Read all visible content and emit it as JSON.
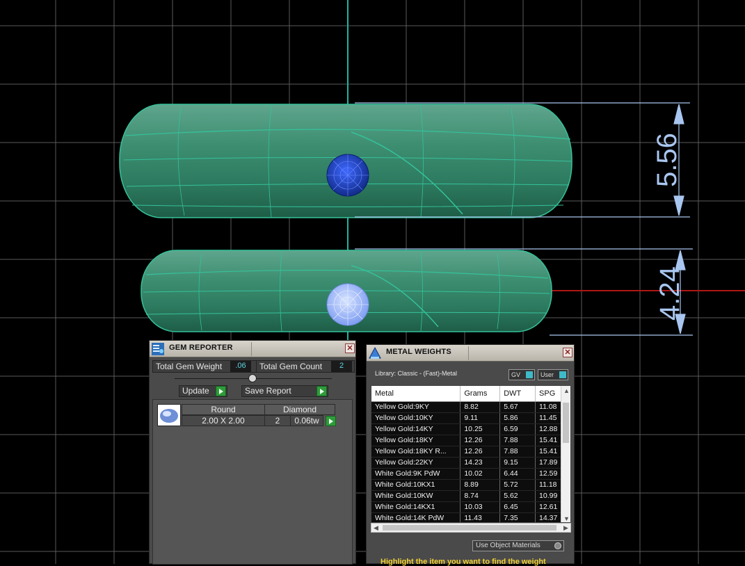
{
  "viewport": {
    "dimension_top": "5.56",
    "dimension_bottom": "4.24",
    "colors": {
      "band": "#2f8a6c",
      "band_edge": "#35c29a",
      "gem_top": "#1f3fb8",
      "gem_bottom": "#a8c2ff",
      "grid": "#5a5a5a",
      "axis_green": "#1fb5a0",
      "axis_red": "#b01515",
      "dimension": "#a9c6f0"
    }
  },
  "gem_reporter": {
    "title": "GEM REPORTER",
    "icon": "gem-reporter-icon",
    "total_weight_label": "Total Gem Weight",
    "total_weight_value": ".06",
    "total_count_label": "Total Gem Count",
    "total_count_value": "2",
    "update_label": "Update",
    "save_report_label": "Save Report",
    "gem": {
      "cut": "Round",
      "stone": "Diamond",
      "size": "2.00 X 2.00",
      "count": "2",
      "weight": "0.06tw",
      "icon": "gem-thumbnail-icon"
    }
  },
  "metal_weights": {
    "title": "METAL WEIGHTS",
    "icon": "metal-weights-icon",
    "library": "Library: Classic - (Fast)-Metal",
    "gv_label": "GV",
    "user_label": "User",
    "columns": [
      "Metal",
      "Grams",
      "DWT",
      "SPG"
    ],
    "rows": [
      [
        "Yellow Gold:9KY",
        "8.82",
        "5.67",
        "11.08"
      ],
      [
        "Yellow Gold:10KY",
        "9.11",
        "5.86",
        "11.45"
      ],
      [
        "Yellow Gold:14KY",
        "10.25",
        "6.59",
        "12.88"
      ],
      [
        "Yellow Gold:18KY",
        "12.26",
        "7.88",
        "15.41"
      ],
      [
        "Yellow Gold:18KY R...",
        "12.26",
        "7.88",
        "15.41"
      ],
      [
        "Yellow Gold:22KY",
        "14.23",
        "9.15",
        "17.89"
      ],
      [
        "White Gold:9K PdW",
        "10.02",
        "6.44",
        "12.59"
      ],
      [
        "White Gold:10KX1",
        "8.89",
        "5.72",
        "11.18"
      ],
      [
        "White Gold:10KW",
        "8.74",
        "5.62",
        "10.99"
      ],
      [
        "White Gold:14KX1",
        "10.03",
        "6.45",
        "12.61"
      ],
      [
        "White Gold:14K PdW",
        "11.43",
        "7.35",
        "14.37"
      ]
    ],
    "use_object_materials": "Use Object Materials",
    "hint": "Highlight the item you want to find the weight"
  }
}
